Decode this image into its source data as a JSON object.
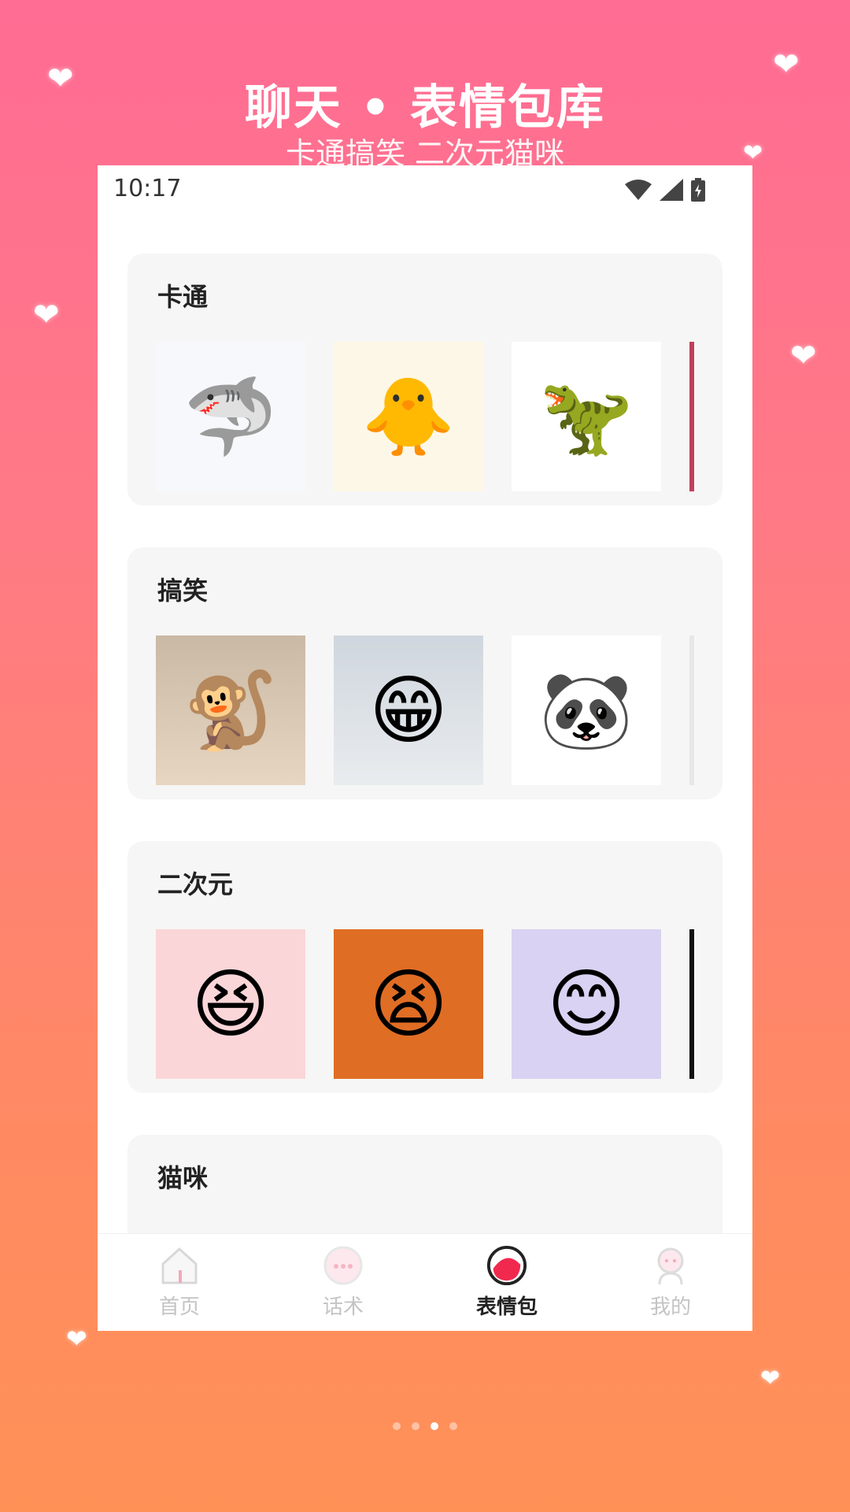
{
  "promo": {
    "title": "聊天 • 表情包库",
    "subtitle": "卡通搞笑 二次元猫咪"
  },
  "status_bar": {
    "time": "10:17",
    "icons": [
      "wifi-icon",
      "signal-icon",
      "battery-icon"
    ]
  },
  "categories": [
    {
      "title": "卡通",
      "stickers": [
        {
          "icon": "shark-cartoon-sticker",
          "glyph": "🦈"
        },
        {
          "icon": "duck-cartoon-sticker",
          "glyph": "🐥"
        },
        {
          "icon": "dinosaur-cartoon-sticker",
          "glyph": "🦖"
        }
      ]
    },
    {
      "title": "搞笑",
      "stickers": [
        {
          "icon": "monkey-meme-sticker",
          "glyph": "🐒"
        },
        {
          "icon": "laughing-man-meme-sticker",
          "glyph": "😁"
        },
        {
          "icon": "panda-head-meme-sticker",
          "glyph": "🐼"
        }
      ]
    },
    {
      "title": "二次元",
      "stickers": [
        {
          "icon": "pink-hair-anime-sticker",
          "glyph": "😆"
        },
        {
          "icon": "orange-hood-anime-sticker",
          "glyph": "😫"
        },
        {
          "icon": "purple-hair-anime-sticker",
          "glyph": "😊"
        }
      ]
    },
    {
      "title": "猫咪",
      "stickers": []
    }
  ],
  "tabbar": {
    "items": [
      {
        "label": "首页",
        "icon": "home-icon",
        "active": false
      },
      {
        "label": "话术",
        "icon": "chat-bubble-icon",
        "active": false
      },
      {
        "label": "表情包",
        "icon": "sticker-icon",
        "active": true
      },
      {
        "label": "我的",
        "icon": "profile-icon",
        "active": false
      }
    ]
  },
  "pager": {
    "count": 4,
    "active_index": 2
  },
  "colors": {
    "gradient_top": "#ff6c94",
    "gradient_bottom": "#ff9157",
    "accent_red": "#f2294e",
    "card_bg": "#f6f6f6"
  }
}
